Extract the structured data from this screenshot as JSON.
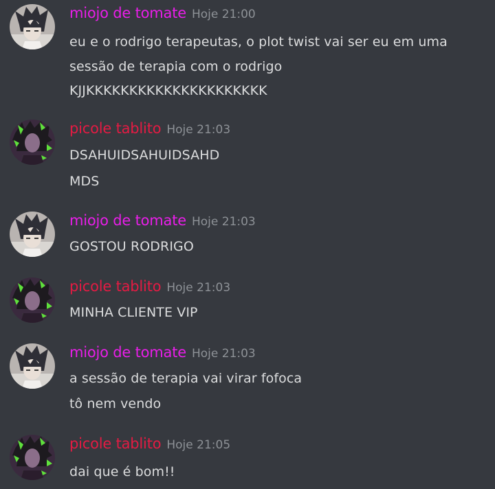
{
  "colors": {
    "background": "#36393f",
    "miojo_name": "#e91ee9",
    "picole_name": "#e31b43",
    "timestamp": "#8e9297",
    "text": "#dcddde"
  },
  "messages": [
    {
      "author": "miojo de tomate",
      "time": "Hoje 21:00",
      "avatar": "naruto-sasuke-avatar",
      "lines": [
        "eu e o rodrigo terapeutas, o plot twist vai ser eu em uma",
        "sessão de terapia com o rodrigo",
        "KJJKKKKKKKKKKKKKKKKKKKKK"
      ]
    },
    {
      "author": "picole tablito",
      "time": "Hoje 21:03",
      "avatar": "green-hair-girl-avatar",
      "lines": [
        "DSAHUIDSAHUIDSAHD",
        "MDS"
      ]
    },
    {
      "author": "miojo de tomate",
      "time": "Hoje 21:03",
      "avatar": "naruto-sasuke-avatar",
      "lines": [
        "GOSTOU RODRIGO"
      ]
    },
    {
      "author": "picole tablito",
      "time": "Hoje 21:03",
      "avatar": "green-hair-girl-avatar",
      "lines": [
        "MINHA CLIENTE VIP"
      ]
    },
    {
      "author": "miojo de tomate",
      "time": "Hoje 21:03",
      "avatar": "naruto-sasuke-avatar",
      "lines": [
        "a sessão de terapia vai virar fofoca",
        "tô nem vendo"
      ]
    },
    {
      "author": "picole tablito",
      "time": "Hoje 21:05",
      "avatar": "green-hair-girl-avatar",
      "lines": [
        "dai que é bom!!"
      ]
    }
  ]
}
